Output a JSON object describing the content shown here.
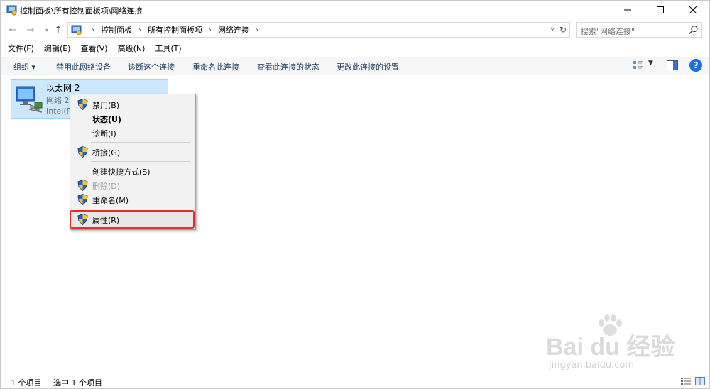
{
  "window": {
    "title": "控制面板\\所有控制面板项\\网络连接"
  },
  "address": {
    "crumbs": [
      "控制面板",
      "所有控制面板项",
      "网络连接"
    ],
    "search_placeholder": "搜索\"网络连接\""
  },
  "menubar": {
    "items": [
      "文件(F)",
      "编辑(E)",
      "查看(V)",
      "高级(N)",
      "工具(T)"
    ]
  },
  "commandbar": {
    "organize": "组织 ▾",
    "disable": "禁用此网络设备",
    "diagnose": "诊断这个连接",
    "rename": "重命名此连接",
    "status": "查看此连接的状态",
    "settings": "更改此连接的设置",
    "help": "?"
  },
  "connection": {
    "name": "以太网 2",
    "network": "网络 2",
    "device": "Intel(R)"
  },
  "context_menu": {
    "items": [
      {
        "label": "禁用(B)",
        "shield": true,
        "bold": false,
        "disabled": false
      },
      {
        "label": "状态(U)",
        "shield": false,
        "bold": true,
        "disabled": false
      },
      {
        "label": "诊断(I)",
        "shield": false,
        "bold": false,
        "disabled": false
      },
      {
        "label": "桥接(G)",
        "shield": true,
        "bold": false,
        "disabled": false
      },
      {
        "label": "创建快捷方式(S)",
        "shield": false,
        "bold": false,
        "disabled": false
      },
      {
        "label": "删除(D)",
        "shield": true,
        "bold": false,
        "disabled": true
      },
      {
        "label": "重命名(M)",
        "shield": true,
        "bold": false,
        "disabled": false
      },
      {
        "label": "属性(R)",
        "shield": true,
        "bold": false,
        "disabled": false
      }
    ],
    "highlighted": "属性(R)"
  },
  "statusbar": {
    "count": "1 个项目",
    "selected": "选中 1 个项目"
  },
  "watermark": {
    "brand": "Bai du 经验",
    "url": "jingyan.baidu.com"
  },
  "colors": {
    "selection_bg": "#cce8ff",
    "highlight_border": "#e0302a",
    "command_text": "#1e395b",
    "help_blue": "#1e6fd9"
  }
}
